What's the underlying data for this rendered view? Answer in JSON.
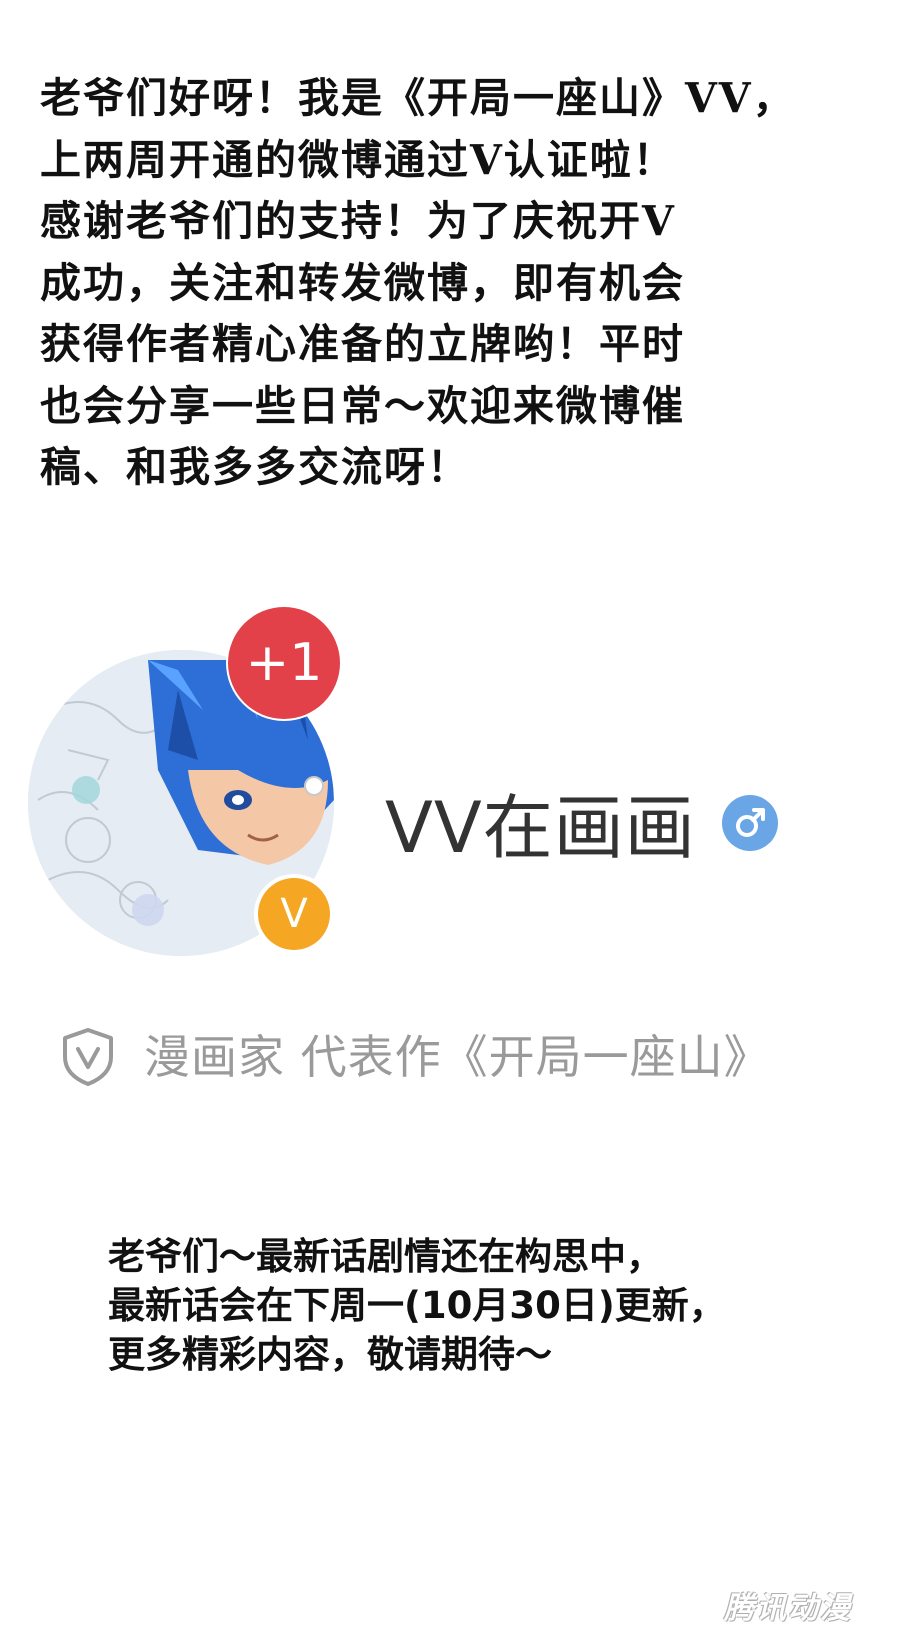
{
  "announcement": {
    "text": "老爷们好呀！我是《开局一座山》VV，\n上两周开通的微博通过V认证啦！\n感谢老爷们的支持！为了庆祝开V\n成功，关注和转发微博，即有机会\n获得作者精心准备的立牌哟！平时\n也会分享一些日常～欢迎来微博催\n稿、和我多多交流呀！"
  },
  "profile": {
    "notification_badge": "+1",
    "verified_badge_letter": "V",
    "username": "VV在画画",
    "gender_icon": "male-icon",
    "certification_icon": "shield-v-icon",
    "certification": "漫画家 代表作《开局一座山》"
  },
  "update_note": {
    "text": "老爷们～最新话剧情还在构思中，\n最新话会在下周一(10月30日)更新，\n更多精彩内容，敬请期待～"
  },
  "watermark": "腾讯动漫",
  "colors": {
    "badge_red": "#e2414a",
    "verified_orange": "#f5a623",
    "gender_blue": "#6aa6e6",
    "muted_gray": "#9a9a9a"
  }
}
